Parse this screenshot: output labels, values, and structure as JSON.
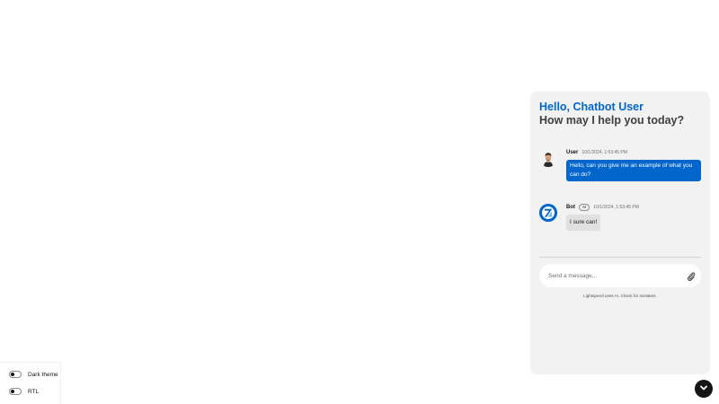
{
  "settings": {
    "dark_theme_label": "Dark theme",
    "rtl_label": "RTL"
  },
  "chatbot": {
    "greeting_hello": "Hello, Chatbot User",
    "greeting_question": "How may I help you today?",
    "messages": [
      {
        "author": "User",
        "timestamp": "10/1/2024, 1:53:45 PM",
        "text": "Hello, can you give me an example of what you can do?"
      },
      {
        "author": "Bot",
        "badge": "AI",
        "timestamp": "10/1/2024, 1:53:45 PM",
        "text": "I sure can!"
      }
    ],
    "input_placeholder": "Send a message...",
    "footnote": "Lightspeed uses AI. Check for mistakes."
  },
  "colors": {
    "accent": "#0066cc",
    "panel_bg": "#f2f2f2",
    "toggle_bg": "#151515"
  },
  "icons": {
    "attach": "paperclip-icon",
    "toggle": "chevron-down-icon",
    "bot_avatar": "bot-logo-icon",
    "user_avatar": "user-avatar"
  }
}
